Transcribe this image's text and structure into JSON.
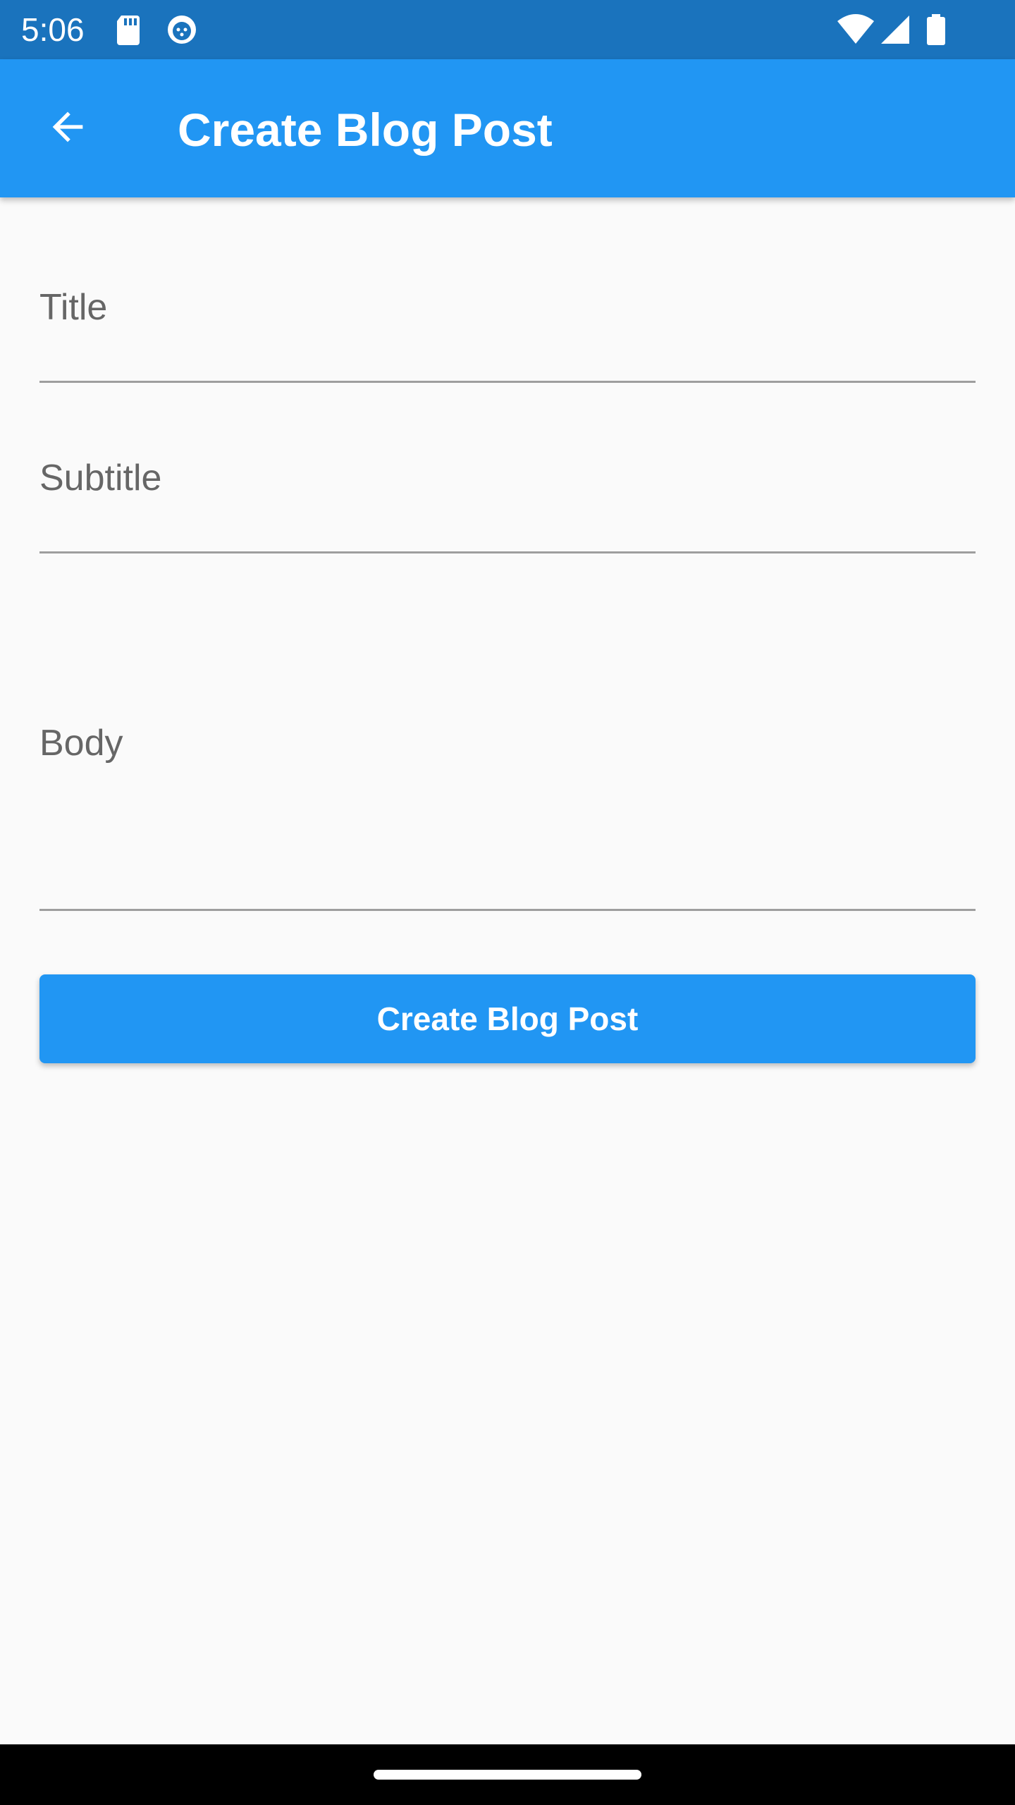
{
  "status_bar": {
    "time": "5:06",
    "icons": [
      "sd-card-icon",
      "notification-app-icon",
      "wifi-icon",
      "cell-signal-icon",
      "battery-icon"
    ]
  },
  "app_bar": {
    "back_icon": "arrow-back-icon",
    "title": "Create Blog Post",
    "color": "#2196f3"
  },
  "form": {
    "title_label": "Title",
    "title_value": "",
    "subtitle_label": "Subtitle",
    "subtitle_value": "",
    "body_label": "Body",
    "body_value": ""
  },
  "actions": {
    "submit_label": "Create Blog Post"
  },
  "colors": {
    "status_bar": "#1a73bd",
    "primary": "#2196f3",
    "background": "#fafafa",
    "label": "#666666",
    "underline": "#9e9e9e"
  }
}
